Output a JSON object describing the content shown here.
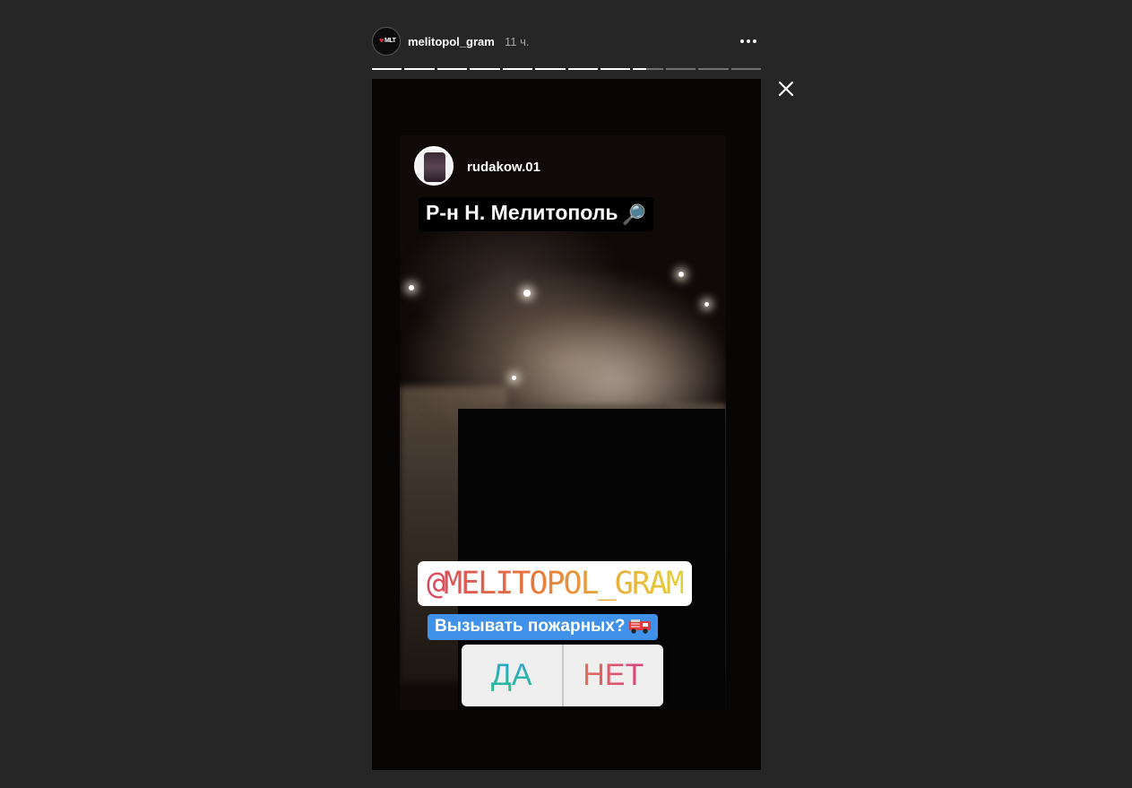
{
  "header": {
    "account_name": "melitopol_gram",
    "time_ago": "11 ч.",
    "avatar_icon": "heart-logo-icon",
    "avatar_text": "MLT",
    "more_icon": "more-options-icon"
  },
  "progress": {
    "segments_total": 12,
    "current_segment": 9,
    "current_segment_progress": 0.45
  },
  "close_icon": "close-icon",
  "story": {
    "reshare": {
      "username": "rudakow.01",
      "avatar_icon": "user-avatar"
    },
    "location_sticker": {
      "text": "Р-н Н. Мелитополь",
      "icon": "🔎"
    },
    "mention_sticker": {
      "text": "@MELITOPOL_GRAM"
    },
    "poll": {
      "question": "Вызывать пожарных?",
      "question_icon": "fire-engine-icon",
      "options": [
        "ДА",
        "НЕТ"
      ]
    }
  },
  "colors": {
    "background": "#262626",
    "poll_question_bg": "#3f91e9",
    "accent_white": "#ffffff"
  }
}
